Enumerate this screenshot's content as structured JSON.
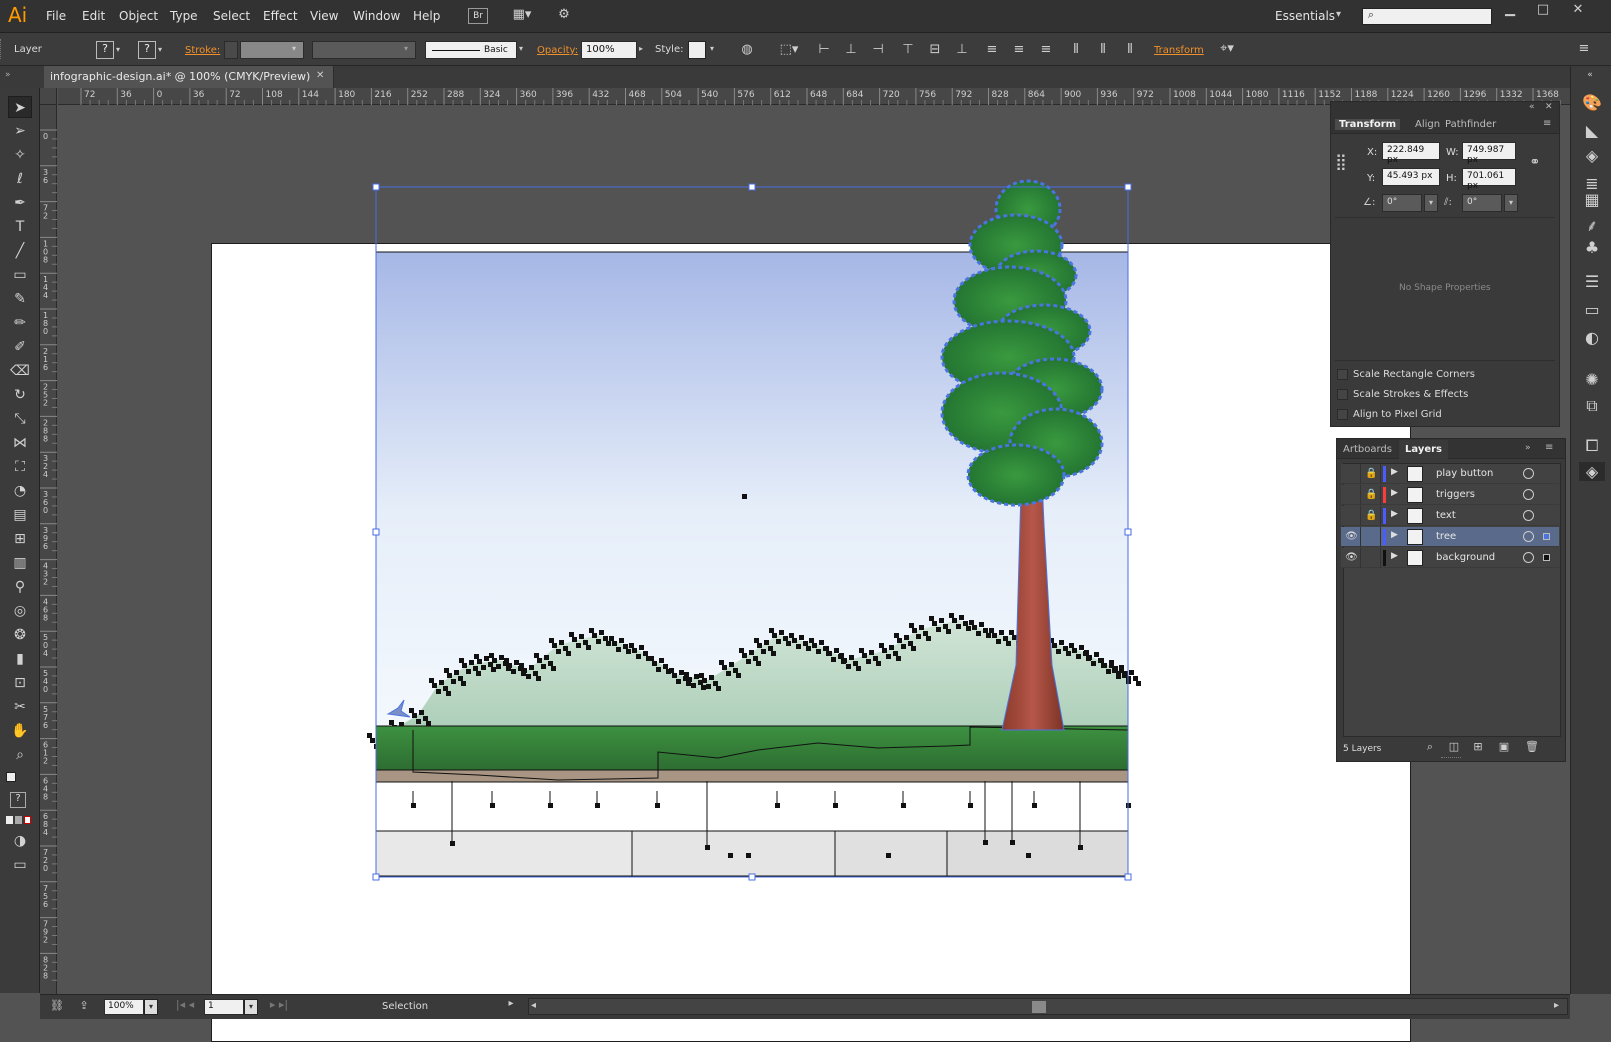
{
  "app": {
    "logo": "Ai"
  },
  "menu": [
    "File",
    "Edit",
    "Object",
    "Type",
    "Select",
    "Effect",
    "View",
    "Window",
    "Help"
  ],
  "bridge_label": "Br",
  "workspace": "Essentials",
  "control": {
    "selection_label": "Layer",
    "stroke_label": "Stroke:",
    "brush_label": "Basic",
    "opacity_label": "Opacity:",
    "opacity_value": "100%",
    "style_label": "Style:",
    "transform_label": "Transform"
  },
  "document": {
    "tab_title": "infographic-design.ai* @ 100% (CMYK/Preview)"
  },
  "ruler": {
    "h_ticks": [
      "72",
      "36",
      "0",
      "36",
      "72",
      "108",
      "144",
      "180",
      "216",
      "252",
      "288",
      "324",
      "360",
      "396",
      "432",
      "468",
      "504",
      "540",
      "576",
      "612",
      "648",
      "684",
      "720",
      "756",
      "792",
      "828",
      "864",
      "900",
      "936",
      "972",
      "1008",
      "1044",
      "1080",
      "1116",
      "1152",
      "1188",
      "1224",
      "1260",
      "1296",
      "1332",
      "1368"
    ],
    "v_ticks": [
      "0",
      "3 6",
      "7 2",
      "1 0 8",
      "1 4 4",
      "1 8 0",
      "2 1 6",
      "2 5 2",
      "2 8 8",
      "3 2 4",
      "3 6 0",
      "3 9 6",
      "4 3 2",
      "4 6 8",
      "5 0 4",
      "5 4 0",
      "5 7 6",
      "6 1 2",
      "6 4 8",
      "6 8 4",
      "7 2 0",
      "7 5 6",
      "7 9 2",
      "8 2 8"
    ]
  },
  "transform_panel": {
    "tabs": [
      "Transform",
      "Align",
      "Pathfinder"
    ],
    "x_label": "X:",
    "x_value": "222.849 px",
    "y_label": "Y:",
    "y_value": "45.493 px",
    "w_label": "W:",
    "w_value": "749.987 px",
    "h_label": "H:",
    "h_value": "701.061 px",
    "rotate_value": "0°",
    "shear_value": "0°",
    "no_shape": "No Shape Properties",
    "options": [
      "Scale Rectangle Corners",
      "Scale Strokes & Effects",
      "Align to Pixel Grid"
    ]
  },
  "layers_panel": {
    "tabs": [
      "Artboards",
      "Layers"
    ],
    "layers": [
      {
        "name": "play button",
        "locked": true,
        "visible": false,
        "color": "#4a5cff"
      },
      {
        "name": "triggers",
        "locked": true,
        "visible": false,
        "color": "#ff3b3b"
      },
      {
        "name": "text",
        "locked": true,
        "visible": false,
        "color": "#4a5cff"
      },
      {
        "name": "tree",
        "locked": false,
        "visible": true,
        "color": "#4a5cff",
        "selected": true
      },
      {
        "name": "background",
        "locked": false,
        "visible": true,
        "color": "#111111"
      }
    ],
    "count": "5 Layers"
  },
  "status": {
    "zoom": "100%",
    "artboard_num": "1",
    "tool": "Selection"
  }
}
